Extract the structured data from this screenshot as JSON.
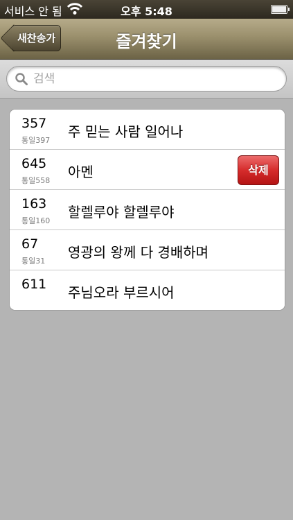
{
  "status_bar": {
    "carrier": "서비스 안 됨",
    "time": "오후 5:48"
  },
  "nav": {
    "title": "즐겨찾기",
    "back_label": "새찬송가"
  },
  "search": {
    "placeholder": "검색",
    "value": ""
  },
  "favorites": [
    {
      "number": "357",
      "sub": "통일397",
      "title": "주 믿는 사람 일어나"
    },
    {
      "number": "645",
      "sub": "통일558",
      "title": "아멘",
      "delete_label": "삭제"
    },
    {
      "number": "163",
      "sub": "통일160",
      "title": "할렐루야 할렐루야"
    },
    {
      "number": "67",
      "sub": "통일31",
      "title": "영광의 왕께 다 경배하며"
    },
    {
      "number": "611",
      "sub": "",
      "title": "주님오라 부르시어"
    }
  ],
  "colors": {
    "nav_bar": "#9a8f6c",
    "delete_button": "#d62c2c",
    "background": "#b4b4b4"
  }
}
